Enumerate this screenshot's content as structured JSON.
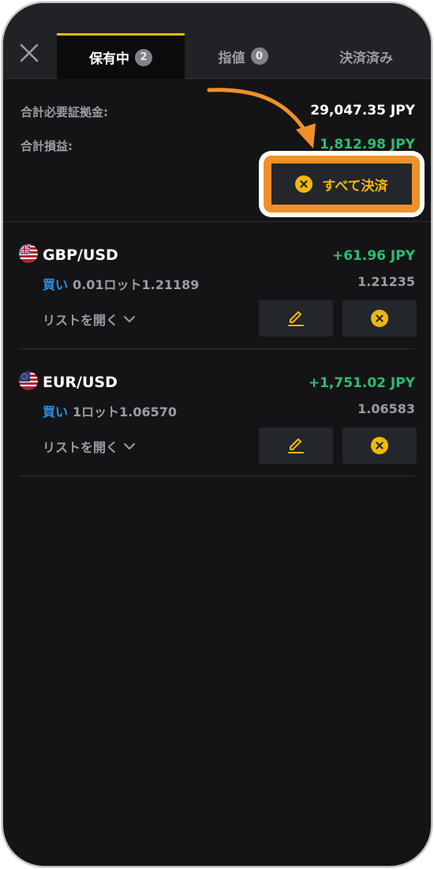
{
  "tabs": [
    {
      "label": "保有中",
      "badge": "2",
      "active": true
    },
    {
      "label": "指値",
      "badge": "0",
      "active": false
    },
    {
      "label": "決済済み",
      "badge": null,
      "active": false
    }
  ],
  "summary": {
    "margin_label": "合計必要証拠金:",
    "margin_value": "29,047.35 JPY",
    "pl_label": "合計損益:",
    "pl_value": "1,812.98 JPY"
  },
  "close_all_label": "すべて決済",
  "positions": [
    {
      "pair": "GBP/USD",
      "pl": "+61.96 JPY",
      "side": "買い",
      "detail": "0.01ロット1.21189",
      "current": "1.21235",
      "list_label": "リストを開く"
    },
    {
      "pair": "EUR/USD",
      "pl": "+1,751.02 JPY",
      "side": "買い",
      "detail": "1ロット1.06570",
      "current": "1.06583",
      "list_label": "リストを開く"
    }
  ],
  "colors": {
    "accent": "#f0b90b",
    "profit": "#2dbd6e",
    "buy": "#2d8fe0",
    "highlight": "#f0902a"
  }
}
